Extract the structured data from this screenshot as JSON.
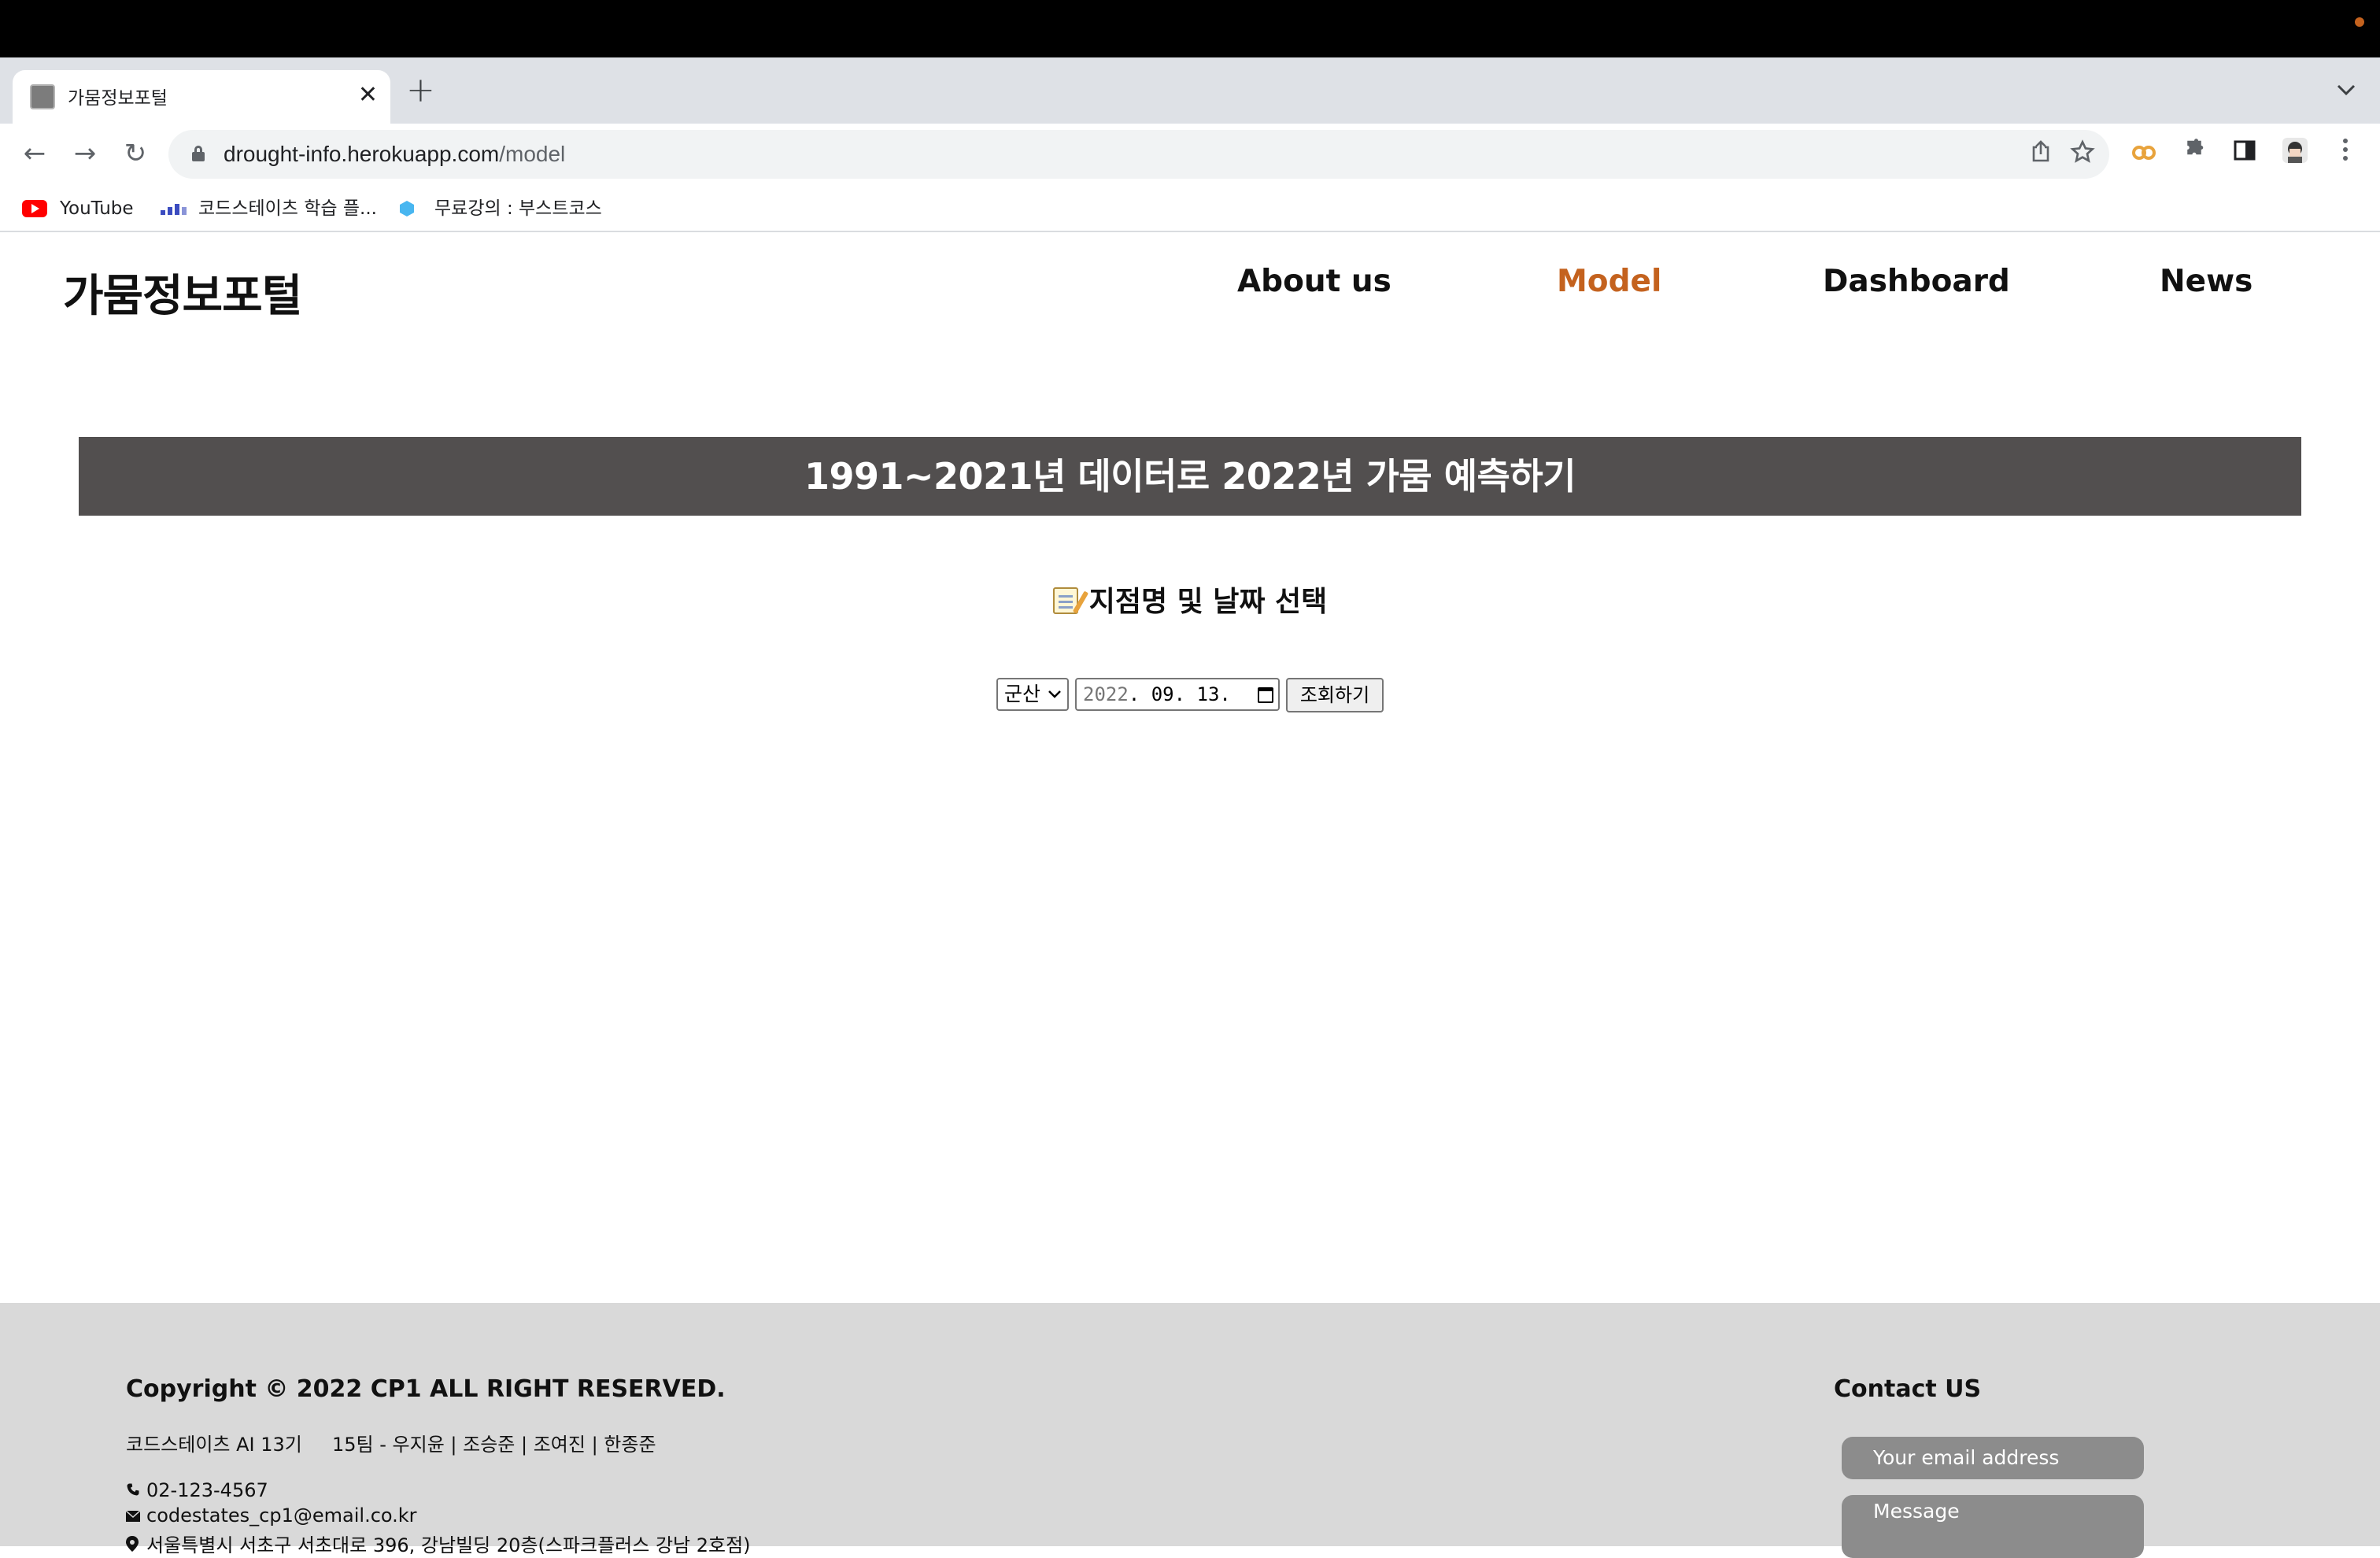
{
  "browser": {
    "tab": {
      "title": "가뭄정보포털",
      "close": "✕",
      "new_tab": "+",
      "tab_list": "⌄"
    },
    "toolbar": {
      "back": "←",
      "forward": "→",
      "reload": "↻"
    },
    "address": {
      "host": "drought-info.herokuapp.com",
      "path": "/model"
    },
    "bookmarks": [
      {
        "label": "YouTube"
      },
      {
        "label": "코드스테이츠 학습 플..."
      },
      {
        "label": "무료강의 : 부스트코스"
      }
    ]
  },
  "site": {
    "logo": "가뭄정보포털",
    "nav": [
      {
        "label": "About us",
        "active": false
      },
      {
        "label": "Model",
        "active": true
      },
      {
        "label": "Dashboard",
        "active": false
      },
      {
        "label": "News",
        "active": false
      }
    ],
    "accent_color": "#c4621e"
  },
  "main": {
    "banner": "1991~2021년 데이터로 2022년 가뭄 예측하기",
    "section_title": "지점명 및 날짜 선택",
    "section_icon": "memo-icon",
    "location_select": {
      "value": "군산"
    },
    "date_input": {
      "year": "2022",
      "rest": ". 09. 13."
    },
    "query_button": "조회하기"
  },
  "footer": {
    "copyright": "Copyright © 2022 CP1 ALL RIGHT RESERVED.",
    "team": "코드스테이츠 AI 13기     15팀 - 우지윤 | 조승준 | 조여진 | 한종준",
    "phone": "02-123-4567",
    "email": "codestates_cp1@email.co.kr",
    "address": "서울특별시 서초구 서초대로 396, 강남빌딩 20층(스파크플러스 강남 2호점)",
    "contact_title": "Contact US",
    "email_placeholder": "Your email address",
    "message_placeholder": "Message"
  }
}
